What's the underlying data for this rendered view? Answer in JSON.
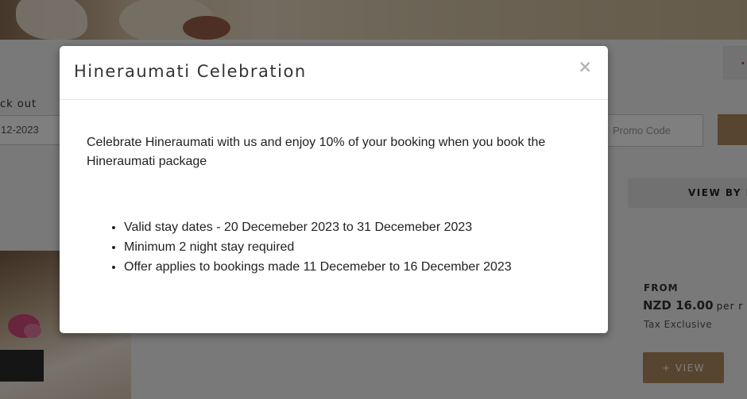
{
  "background": {
    "checkout_label": "ck out",
    "checkout_value": "12-2023",
    "promo_placeholder": "Promo Code",
    "view_by_label": "VIEW BY P",
    "price": {
      "from_label": "FROM",
      "amount": "NZD 16.00",
      "per_label": "per r",
      "tax_note": "Tax Exclusive"
    },
    "view_button_label": "+ VIEW",
    "accent_color": "#b08a5e"
  },
  "modal": {
    "title": "Hineraumati Celebration",
    "close_label": "×",
    "description": "Celebrate Hineraumati with us and enjoy 10% of your booking when you book the Hineraumati package",
    "offer_items": [
      "Valid stay dates - 20 Decemeber 2023 to 31 Decemeber 2023",
      "Minimum 2 night stay required",
      "Offer applies to bookings made 11 Decemeber to 16 December 2023"
    ]
  }
}
